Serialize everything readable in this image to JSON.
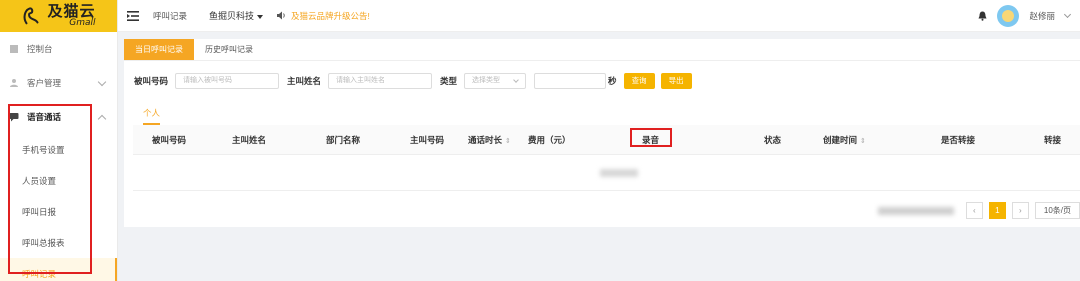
{
  "brand": {
    "name_cn": "及猫云",
    "name_en": "Gmall"
  },
  "sidebar": {
    "items": [
      {
        "label": "控制台"
      },
      {
        "label": "客户管理"
      },
      {
        "label": "语音通话"
      }
    ],
    "sub_items": [
      {
        "label": "手机号设置"
      },
      {
        "label": "人员设置"
      },
      {
        "label": "呼叫日报"
      },
      {
        "label": "呼叫总报表"
      },
      {
        "label": "呼叫记录"
      }
    ]
  },
  "topbar": {
    "breadcrumb": "呼叫记录",
    "company": "鱼掘贝科技",
    "notice": "及猫云品牌升级公告!",
    "user_name": "赵修丽"
  },
  "tabs": [
    {
      "label": "当日呼叫记录"
    },
    {
      "label": "历史呼叫记录"
    }
  ],
  "filters": {
    "called_label": "被叫号码",
    "called_placeholder": "请输入被叫号码",
    "caller_label": "主叫姓名",
    "caller_placeholder": "请输入主叫姓名",
    "type_label": "类型",
    "type_placeholder": "选择类型",
    "seconds_label": "秒",
    "query_button": "查询",
    "export_button": "导出"
  },
  "subtab": "个人",
  "table": {
    "columns": [
      "被叫号码",
      "主叫姓名",
      "部门名称",
      "主叫号码",
      "通话时长",
      "费用（元）",
      "录音",
      "状态",
      "创建时间",
      "是否转接",
      "转接"
    ]
  },
  "pagination": {
    "current_page": "1",
    "page_size": "10条/页"
  },
  "colors": {
    "accent": "#f5a623",
    "logo_bg": "#f5c518",
    "highlight": "#e02020"
  }
}
